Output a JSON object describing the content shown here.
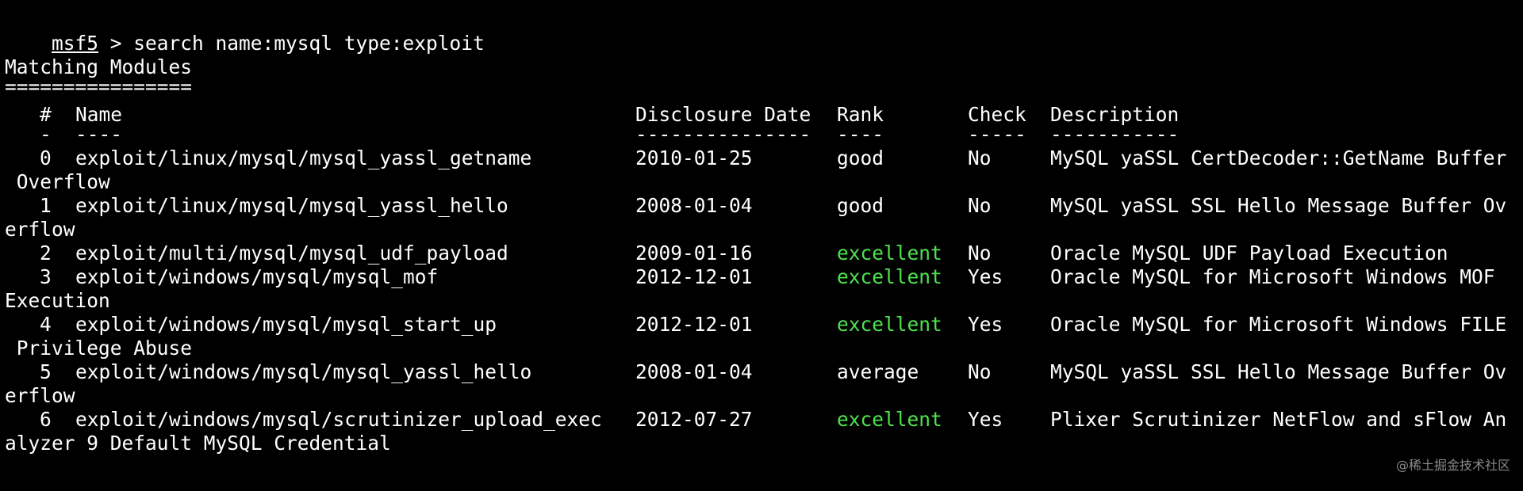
{
  "prompt": {
    "name": "msf5",
    "symbol": " > ",
    "command": "search name:mysql type:exploit"
  },
  "heading": {
    "title": "Matching Modules",
    "underline": "================"
  },
  "table": {
    "headers": {
      "num": "#",
      "name": "Name",
      "date": "Disclosure Date",
      "rank": "Rank",
      "check": "Check",
      "desc": "Description"
    },
    "separators": {
      "num": "-",
      "name": "----",
      "date": "---------------",
      "rank": "----",
      "check": "-----",
      "desc": "-----------"
    },
    "rows": [
      {
        "num": "0",
        "name": "exploit/linux/mysql/mysql_yassl_getname",
        "date": "2010-01-25",
        "rank": "good",
        "check": "No",
        "desc": "MySQL yaSSL CertDecoder::GetName Buffer",
        "wrap": " Overflow",
        "rank_color": "#ffffff"
      },
      {
        "num": "1",
        "name": "exploit/linux/mysql/mysql_yassl_hello",
        "date": "2008-01-04",
        "rank": "good",
        "check": "No",
        "desc": "MySQL yaSSL SSL Hello Message Buffer Ov",
        "wrap": "erflow",
        "rank_color": "#ffffff"
      },
      {
        "num": "2",
        "name": "exploit/multi/mysql/mysql_udf_payload",
        "date": "2009-01-16",
        "rank": "excellent",
        "check": "No",
        "desc": "Oracle MySQL UDF Payload Execution",
        "wrap": "",
        "rank_color": "#4ee24e"
      },
      {
        "num": "3",
        "name": "exploit/windows/mysql/mysql_mof",
        "date": "2012-12-01",
        "rank": "excellent",
        "check": "Yes",
        "desc": "Oracle MySQL for Microsoft Windows MOF",
        "wrap": "Execution",
        "rank_color": "#4ee24e"
      },
      {
        "num": "4",
        "name": "exploit/windows/mysql/mysql_start_up",
        "date": "2012-12-01",
        "rank": "excellent",
        "check": "Yes",
        "desc": "Oracle MySQL for Microsoft Windows FILE",
        "wrap": " Privilege Abuse",
        "rank_color": "#4ee24e"
      },
      {
        "num": "5",
        "name": "exploit/windows/mysql/mysql_yassl_hello",
        "date": "2008-01-04",
        "rank": "average",
        "check": "No",
        "desc": "MySQL yaSSL SSL Hello Message Buffer Ov",
        "wrap": "erflow",
        "rank_color": "#ffffff"
      },
      {
        "num": "6",
        "name": "exploit/windows/mysql/scrutinizer_upload_exec",
        "date": "2012-07-27",
        "rank": "excellent",
        "check": "Yes",
        "desc": "Plixer Scrutinizer NetFlow and sFlow An",
        "wrap": "alyzer 9 Default MySQL Credential",
        "rank_color": "#4ee24e"
      }
    ]
  },
  "watermark": "@稀土掘金技术社区",
  "colors": {
    "background": "#000000",
    "foreground": "#ffffff",
    "rank_excellent": "#4ee24e"
  }
}
